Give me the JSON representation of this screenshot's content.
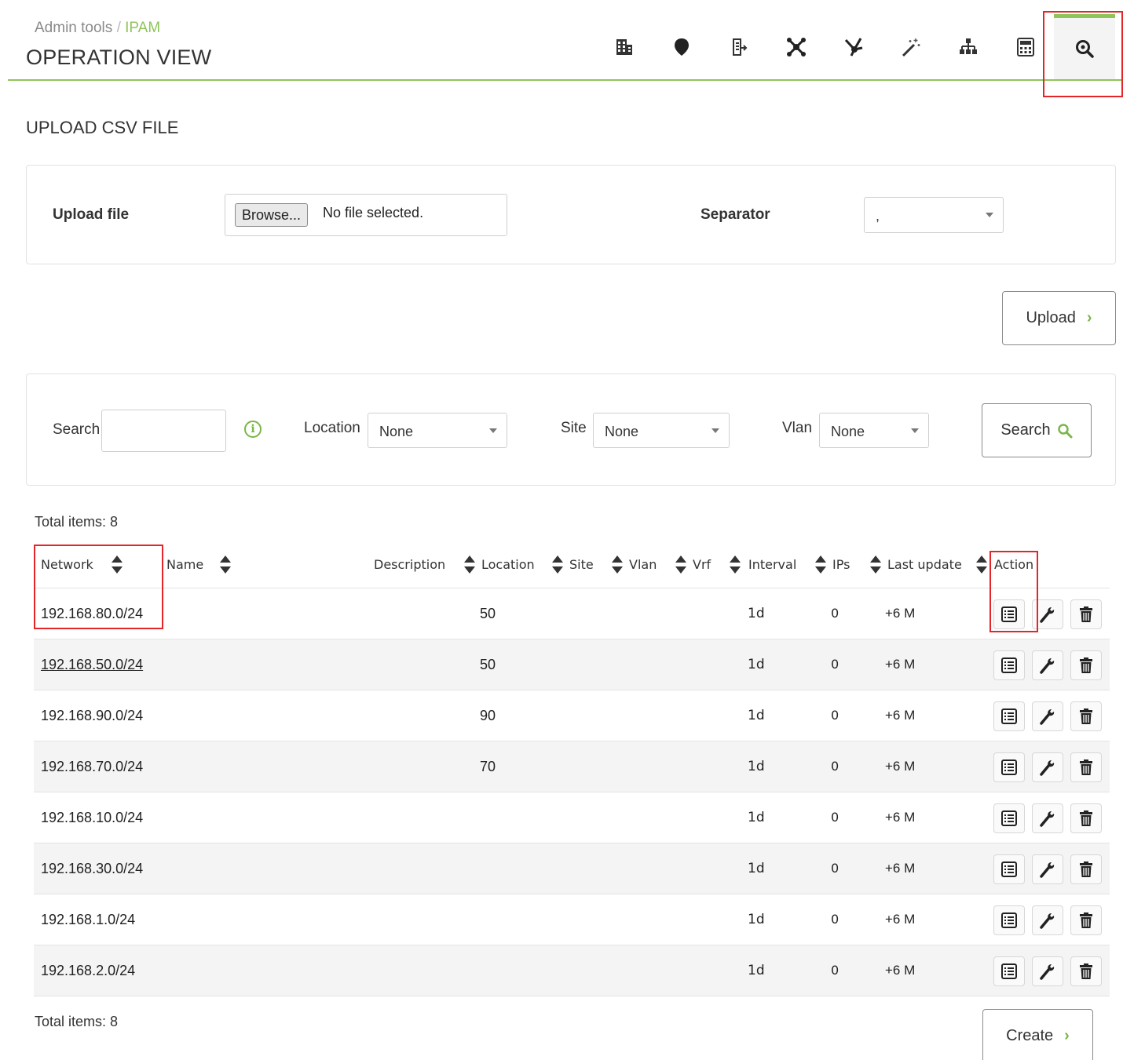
{
  "header": {
    "breadcrumb_root": "Admin tools",
    "breadcrumb_sep": "/",
    "breadcrumb_current": "IPAM",
    "title": "OPERATION VIEW",
    "tabs": [
      {
        "icon": "building-icon",
        "active": false
      },
      {
        "icon": "map-pin-icon",
        "active": false
      },
      {
        "icon": "export-list-icon",
        "active": false
      },
      {
        "icon": "network-scan-icon",
        "active": false
      },
      {
        "icon": "superset-icon",
        "active": false
      },
      {
        "icon": "magic-wand-icon",
        "active": false
      },
      {
        "icon": "hierarchy-icon",
        "active": false
      },
      {
        "icon": "calculator-icon",
        "active": false
      },
      {
        "icon": "magnifier-icon",
        "active": true
      }
    ]
  },
  "upload": {
    "section_title": "UPLOAD CSV FILE",
    "file_label": "Upload file",
    "browse_label": "Browse...",
    "file_status": "No file selected.",
    "separator_label": "Separator",
    "separator_value": ",",
    "upload_button": "Upload"
  },
  "filters": {
    "search_label": "Search",
    "search_value": "",
    "location_label": "Location",
    "location_value": "None",
    "site_label": "Site",
    "site_value": "None",
    "vlan_label": "Vlan",
    "vlan_value": "None",
    "search_button": "Search"
  },
  "table": {
    "total_top": "Total items: 8",
    "total_bottom": "Total items: 8",
    "headers": {
      "network": "Network",
      "name": "Name",
      "description": "Description",
      "location": "Location",
      "site": "Site",
      "vlan": "Vlan",
      "vrf": "Vrf",
      "interval": "Interval",
      "ips": "IPs",
      "last_update": "Last update",
      "action": "Action"
    },
    "rows": [
      {
        "network": "192.168.80.0/24",
        "location": "50",
        "interval": "1d",
        "ips": "0",
        "last_update": "+6 M"
      },
      {
        "network": "192.168.50.0/24",
        "location": "50",
        "interval": "1d",
        "ips": "0",
        "last_update": "+6 M"
      },
      {
        "network": "192.168.90.0/24",
        "location": "90",
        "interval": "1d",
        "ips": "0",
        "last_update": "+6 M"
      },
      {
        "network": "192.168.70.0/24",
        "location": "70",
        "interval": "1d",
        "ips": "0",
        "last_update": "+6 M"
      },
      {
        "network": "192.168.10.0/24",
        "location": "",
        "interval": "1d",
        "ips": "0",
        "last_update": "+6 M"
      },
      {
        "network": "192.168.30.0/24",
        "location": "",
        "interval": "1d",
        "ips": "0",
        "last_update": "+6 M"
      },
      {
        "network": "192.168.1.0/24",
        "location": "",
        "interval": "1d",
        "ips": "0",
        "last_update": "+6 M"
      },
      {
        "network": "192.168.2.0/24",
        "location": "",
        "interval": "1d",
        "ips": "0",
        "last_update": "+6 M"
      }
    ]
  },
  "create_button": "Create",
  "colors": {
    "accent": "#8fc45a",
    "highlight_box": "#e2262a",
    "alt_row": "#f4f4f4"
  }
}
